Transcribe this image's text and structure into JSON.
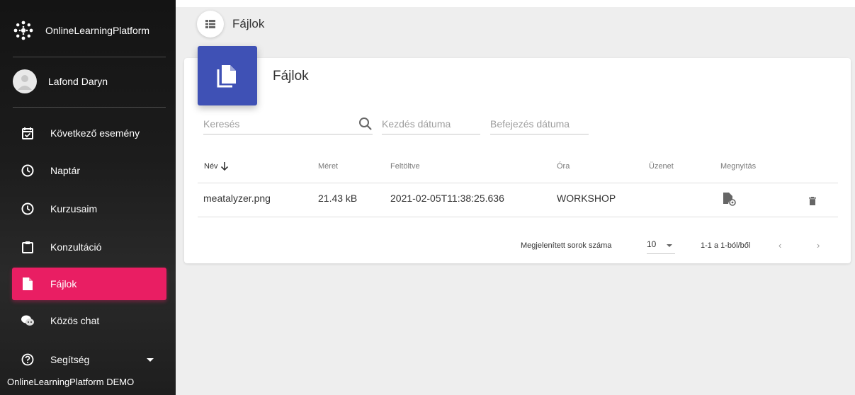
{
  "app": {
    "brand": "OnlineLearningPlatform",
    "footer": "OnlineLearningPlatform DEMO"
  },
  "user": {
    "name": "Lafond Daryn"
  },
  "sidebar": {
    "items": [
      {
        "label": "Következő esemény",
        "icon": "calendar-check-icon"
      },
      {
        "label": "Naptár",
        "icon": "clock-icon"
      },
      {
        "label": "Kurzusaim",
        "icon": "clock-icon"
      },
      {
        "label": "Konzultáció",
        "icon": "clipboard-icon"
      },
      {
        "label": "Fájlok",
        "icon": "file-icon",
        "active": true
      },
      {
        "label": "Közös chat",
        "icon": "chat-icon"
      },
      {
        "label": "Segítség",
        "icon": "help-icon"
      }
    ]
  },
  "topbar": {
    "title": "Fájlok"
  },
  "card": {
    "title": "Fájlok",
    "search_placeholder": "Keresés",
    "start_date_placeholder": "Kezdés dátuma",
    "end_date_placeholder": "Befejezés dátuma"
  },
  "table": {
    "columns": [
      "Név",
      "Méret",
      "Feltöltve",
      "Óra",
      "Üzenet",
      "Megnyitás"
    ],
    "rows": [
      {
        "name": "meatalyzer.png",
        "size": "21.43 kB",
        "uploaded": "2021-02-05T11:38:25.636",
        "lesson": "WORKSHOP",
        "message": ""
      }
    ]
  },
  "pagination": {
    "rows_label": "Megjelenített sorok száma",
    "rows_value": "10",
    "range": "1-1 a 1-ból/ből",
    "prev": "‹",
    "next": "›"
  },
  "colors": {
    "accent": "#e91e63",
    "card_icon": "#3f51b5"
  }
}
